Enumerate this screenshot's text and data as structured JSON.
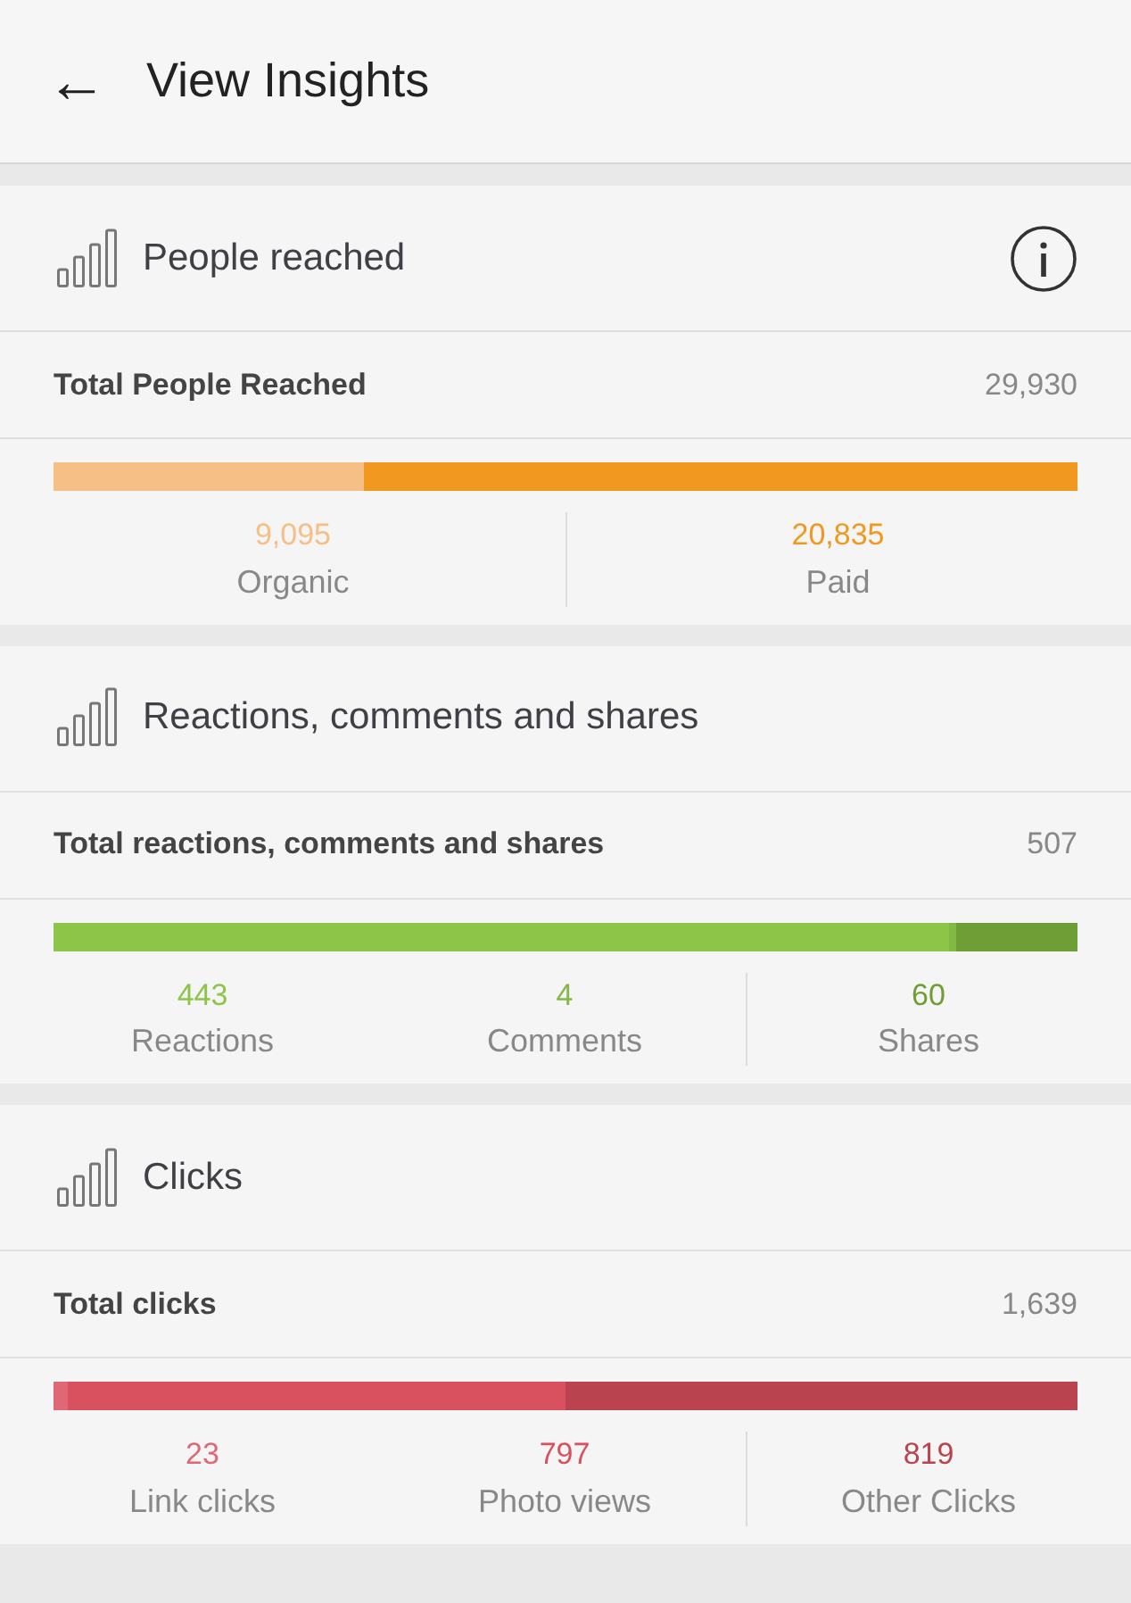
{
  "header": {
    "back_icon": "←",
    "title": "View Insights"
  },
  "sections": [
    {
      "title": "People reached",
      "info": true,
      "total_label": "Total People Reached",
      "total_value": "29,930",
      "segments": [
        {
          "value": "9,095",
          "label": "Organic",
          "color": "#f5bf86",
          "divider_before": false
        },
        {
          "value": "20,835",
          "label": "Paid",
          "color": "#f0981f",
          "divider_before": true
        }
      ]
    },
    {
      "title": "Reactions, comments and shares",
      "info": false,
      "total_label": "Total reactions, comments and shares",
      "total_value": "507",
      "segments": [
        {
          "value": "443",
          "label": "Reactions",
          "color": "#8dc549",
          "divider_before": false
        },
        {
          "value": "4",
          "label": "Comments",
          "color": "#83b845",
          "divider_before": false
        },
        {
          "value": "60",
          "label": "Shares",
          "color": "#6e9e35",
          "divider_before": true
        }
      ]
    },
    {
      "title": "Clicks",
      "info": false,
      "total_label": "Total clicks",
      "total_value": "1,639",
      "segments": [
        {
          "value": "23",
          "label": "Link clicks",
          "color": "#e06776",
          "divider_before": false
        },
        {
          "value": "797",
          "label": "Photo views",
          "color": "#d9505f",
          "divider_before": false
        },
        {
          "value": "819",
          "label": "Other Clicks",
          "color": "#b9434f",
          "divider_before": true
        }
      ]
    }
  ]
}
